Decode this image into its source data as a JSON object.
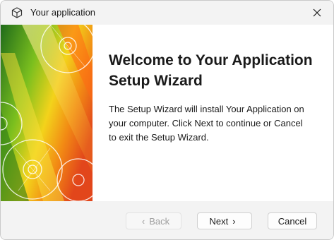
{
  "window": {
    "title": "Your application",
    "close_icon": "close-icon",
    "app_icon": "cube-icon"
  },
  "banner": {
    "image": "cd-disc-artwork",
    "colors": [
      "#2f7d1f",
      "#8fc61e",
      "#f7d21a",
      "#f07a10",
      "#e0421a"
    ]
  },
  "content": {
    "heading_line1": "Welcome to Your Application",
    "heading_line2": "Setup Wizard",
    "body_line1": "The Setup Wizard will install Your Application on",
    "body_line2": "your computer. Click Next to continue or Cancel",
    "body_line3": "to exit the Setup Wizard."
  },
  "footer": {
    "back_label": "Back",
    "back_icon": "chevron-left-icon",
    "back_enabled": false,
    "next_label": "Next",
    "next_icon": "chevron-right-icon",
    "cancel_label": "Cancel"
  }
}
